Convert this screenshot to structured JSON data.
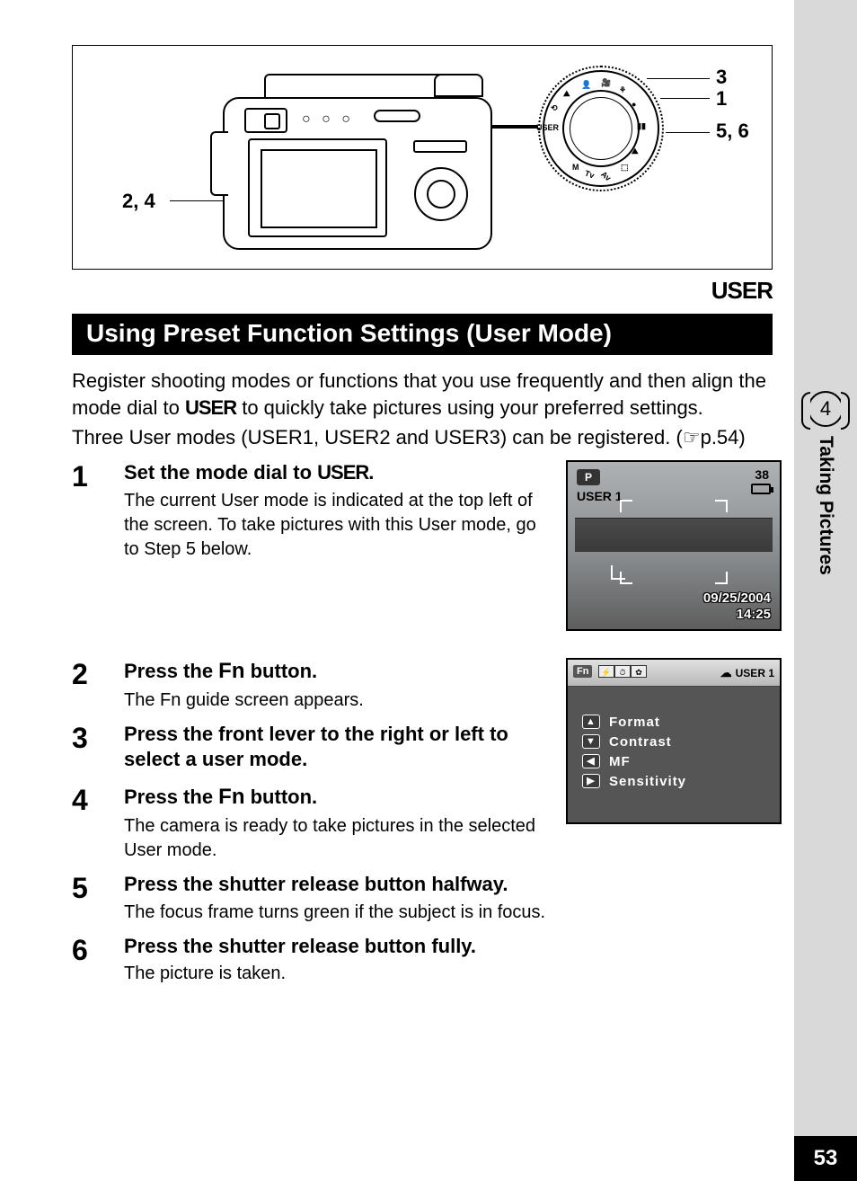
{
  "diagram": {
    "label_left": "2, 4",
    "label_r1": "3",
    "label_r2": "1",
    "label_r3": "5, 6",
    "dial_user": "USER"
  },
  "tag_user": "USER",
  "heading": "Using Preset Function Settings (User Mode)",
  "intro": {
    "line1a": "Register shooting modes or functions that you use frequently and then align the mode dial to ",
    "line1b": " to quickly take pictures using your preferred settings.",
    "user_word": "USER",
    "line2": "Three User modes (USER1, USER2 and USER3) can be registered. (",
    "cross_ref": "p.54",
    "line2_end": ")"
  },
  "steps": [
    {
      "num": "1",
      "heading_a": "Set the mode dial to ",
      "heading_user": "USER",
      "heading_b": ".",
      "desc": "The current User mode is indicated at the top left of the screen. To take pictures with this User mode, go to Step 5 below."
    },
    {
      "num": "2",
      "heading_a": "Press the ",
      "heading_fn": "Fn",
      "heading_b": " button.",
      "desc": "The Fn guide screen appears."
    },
    {
      "num": "3",
      "heading_a": "Press the front lever to the right or left to select a user mode.",
      "desc": ""
    },
    {
      "num": "4",
      "heading_a": "Press the ",
      "heading_fn": "Fn",
      "heading_b": " button.",
      "desc": "The camera is ready to take pictures in the selected User mode."
    },
    {
      "num": "5",
      "heading_a": "Press the shutter release button halfway.",
      "desc": "The focus frame turns green if the subject is in focus."
    },
    {
      "num": "6",
      "heading_a": "Press the shutter release button fully.",
      "desc": "The picture is taken."
    }
  ],
  "lcd1": {
    "mode_p": "P",
    "user1": "USER 1",
    "count": "38",
    "date": "09/25/2004",
    "time": "14:25"
  },
  "lcd2": {
    "fn": "Fn",
    "mode": "USER 1",
    "items": [
      {
        "key": "▲",
        "label": "Format"
      },
      {
        "key": "▼",
        "label": "Contrast"
      },
      {
        "key": "◀",
        "label": "MF"
      },
      {
        "key": "▶",
        "label": "Sensitivity"
      }
    ]
  },
  "side": {
    "chapter_num": "4",
    "chapter_title": "Taking Pictures"
  },
  "page_number": "53"
}
